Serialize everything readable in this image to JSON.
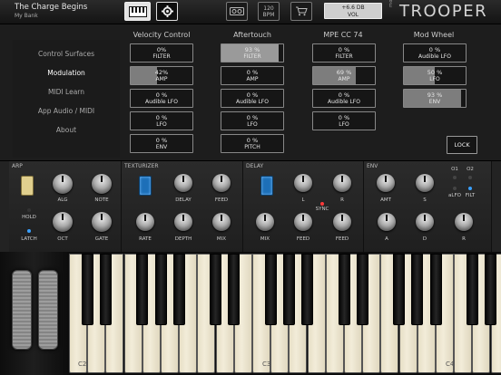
{
  "header": {
    "preset_name": "The Charge Begins",
    "bank_name": "My Bank",
    "tempo_value": "120",
    "tempo_unit": "BPM",
    "volume_value": "+6.6 DB",
    "volume_label": "VOL",
    "brand_small": "moog",
    "brand": "TROOPER",
    "icons": [
      "keyboard-icon",
      "gear-icon",
      "tape-icon",
      "store-icon"
    ]
  },
  "sidebar": {
    "items": [
      {
        "label": "Control Surfaces",
        "active": false
      },
      {
        "label": "Modulation",
        "active": true
      },
      {
        "label": "MIDI Learn",
        "active": false
      },
      {
        "label": "App Audio / MIDI",
        "active": false
      },
      {
        "label": "About",
        "active": false
      }
    ]
  },
  "modulation": {
    "columns": [
      {
        "title": "Velocity Control",
        "slots": [
          {
            "value": "0%",
            "dest": "FILTER",
            "level": 0
          },
          {
            "value": "42%",
            "dest": "AMP",
            "level": 0.42
          },
          {
            "value": "0 %",
            "dest": "Audible LFO",
            "level": 0
          },
          {
            "value": "0 %",
            "dest": "LFO",
            "level": 0
          },
          {
            "value": "0 %",
            "dest": "ENV",
            "level": 0
          }
        ]
      },
      {
        "title": "Aftertouch",
        "slots": [
          {
            "value": "93 %",
            "dest": "FILTER",
            "level": 0.93
          },
          {
            "value": "0 %",
            "dest": "AMP",
            "level": 0
          },
          {
            "value": "0 %",
            "dest": "Audible LFO",
            "level": 0
          },
          {
            "value": "0 %",
            "dest": "LFO",
            "level": 0
          },
          {
            "value": "0 %",
            "dest": "PITCH",
            "level": 0
          }
        ]
      },
      {
        "title": "MPE CC 74",
        "slots": [
          {
            "value": "0 %",
            "dest": "FILTER",
            "level": 0
          },
          {
            "value": "69 %",
            "dest": "AMP",
            "level": 0.69
          },
          {
            "value": "0 %",
            "dest": "Audible LFO",
            "level": 0
          },
          {
            "value": "0 %",
            "dest": "LFO",
            "level": 0
          }
        ]
      },
      {
        "title": "Mod Wheel",
        "slots": [
          {
            "value": "0 %",
            "dest": "Audible LFO",
            "level": 0
          },
          {
            "value": "50 %",
            "dest": "LFO",
            "level": 0.5
          },
          {
            "value": "93 %",
            "dest": "ENV",
            "level": 0.93
          }
        ]
      }
    ],
    "lock_label": "LOCK"
  },
  "synth": {
    "arp": {
      "title": "ARP",
      "labels": [
        "ALG",
        "NOTE",
        "HOLD",
        "OCT",
        "GATE",
        "LATCH"
      ]
    },
    "texturizer": {
      "title": "TEXTURIZER",
      "labels": [
        "DELAY",
        "FEED",
        "RATE",
        "DEPTH",
        "MIX"
      ]
    },
    "delay": {
      "title": "DELAY",
      "labels": [
        "L",
        "R",
        "SYNC",
        "MIX",
        "FEED",
        "FEED"
      ]
    },
    "env": {
      "title": "ENV",
      "labels": [
        "AMT",
        "S",
        "A",
        "D",
        "R",
        "O1",
        "O2",
        "aLFO",
        "FILT"
      ]
    }
  },
  "keyboard": {
    "labels": [
      "C2",
      "C3",
      "C4"
    ]
  },
  "colors": {
    "accent_blue": "#1d6fb8",
    "slot_fill": "#7d7d7d",
    "panel": "#1d1d1d"
  }
}
